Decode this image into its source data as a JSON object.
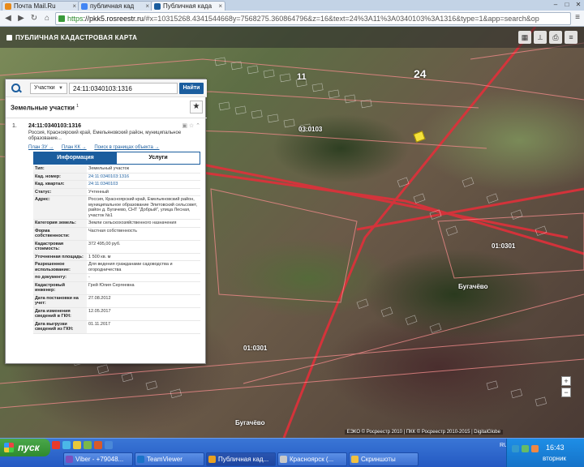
{
  "browser": {
    "tabs": [
      {
        "label": "Почта Mail.Ru",
        "icon": "mail-icon",
        "color": "#e88a1a"
      },
      {
        "label": "публичная кад",
        "icon": "google-icon",
        "color": "#4285f4"
      },
      {
        "label": "Публичная када",
        "icon": "pkk-icon",
        "color": "#1b5d9e"
      }
    ],
    "url_scheme": "https",
    "url_host": "://pkk5.rosreestr.ru",
    "url_rest": "/#x=10315268.4341544668y=7568275.360864796&z=16&text=24%3A11%3A0340103%3A1316&type=1&app=search&op"
  },
  "map": {
    "title": "ПУБЛИЧНАЯ КАДАСТРОВАЯ КАРТА",
    "labels": [
      {
        "text": "24",
        "size": "big"
      },
      {
        "text": "11",
        "size": "med"
      },
      {
        "text": "03:0103",
        "size": "small"
      },
      {
        "text": "01:0301",
        "size": "small"
      },
      {
        "text": "Бугачёво",
        "size": "small"
      },
      {
        "text": "01:0301",
        "size": "small"
      },
      {
        "text": "Бугачёво",
        "size": "small"
      }
    ],
    "copyright": "ЕЭКО © Росреестр 2010 | ПКК © Росреестр 2010-2015 | DigitalGlobe",
    "zoom_in": "+",
    "zoom_out": "−"
  },
  "panel": {
    "search": {
      "type_label": "Участки",
      "query": "24:11:0340103:1316",
      "button": "Найти"
    },
    "results_title": "Земельные участки",
    "results_count": "1",
    "item": {
      "num": "1.",
      "cadnum": "24:11:0340103:1316",
      "address": "Россия, Красноярский край, Емельяновский район, муниципальное образование...",
      "links": [
        "План ЗУ →",
        "План КК →",
        "Поиск в границах объекта →"
      ]
    },
    "tabs": [
      "Информация",
      "Услуги"
    ],
    "rows": [
      {
        "k": "Тип:",
        "v": "Земельный участок",
        "link": false
      },
      {
        "k": "Кад. номер:",
        "v": "24:11:0340103:1316",
        "link": true
      },
      {
        "k": "Кад. квартал:",
        "v": "24:11:0340103",
        "link": true
      },
      {
        "k": "Статус:",
        "v": "Учтенный",
        "link": false
      },
      {
        "k": "Адрес:",
        "v": "Россия, Красноярский край, Емельяновский район, муниципальное образование Элитовский сельсовет, район д. Бугачево, СНТ \"Добрый\", улица Лесная, участок №1",
        "link": false
      },
      {
        "k": "Категория земель:",
        "v": "Земли сельскохозяйственного назначения",
        "link": false
      },
      {
        "k": "Форма собственности:",
        "v": "Частная собственность",
        "link": false
      },
      {
        "k": "Кадастровая стоимость:",
        "v": "372 495,00 руб.",
        "link": false
      },
      {
        "k": "Уточненная площадь:",
        "v": "1 500 кв. м",
        "link": false
      },
      {
        "k": "Разрешенное использование:",
        "v": "Для ведения гражданами садоводства и огородничества",
        "link": false
      },
      {
        "k": "по документу:",
        "v": "-",
        "link": false
      },
      {
        "k": "Кадастровый инженер:",
        "v": "Грей Юлия Сергеевна",
        "link": false
      },
      {
        "k": "Дата постановки на учет:",
        "v": "27.08.2012",
        "link": false
      },
      {
        "k": "Дата изменения сведений в ГКН:",
        "v": "12.05.2017",
        "link": false
      },
      {
        "k": "Дата выгрузки сведений из ГКН:",
        "v": "01.11.2017",
        "link": false
      }
    ]
  },
  "taskbar": {
    "start": "пуск",
    "items": [
      {
        "label": "Viber - +79048...",
        "color": "#7b4fbd"
      },
      {
        "label": "TeamViewer",
        "color": "#1a73c8"
      },
      {
        "label": "Публичная кад...",
        "color": "#e8a020"
      },
      {
        "label": "Красноярск (...",
        "color": "#c8c8c8"
      },
      {
        "label": "Скриншоты",
        "color": "#f0c040"
      }
    ],
    "lang": "RU",
    "time": "16:43",
    "weekday": "вторник"
  }
}
